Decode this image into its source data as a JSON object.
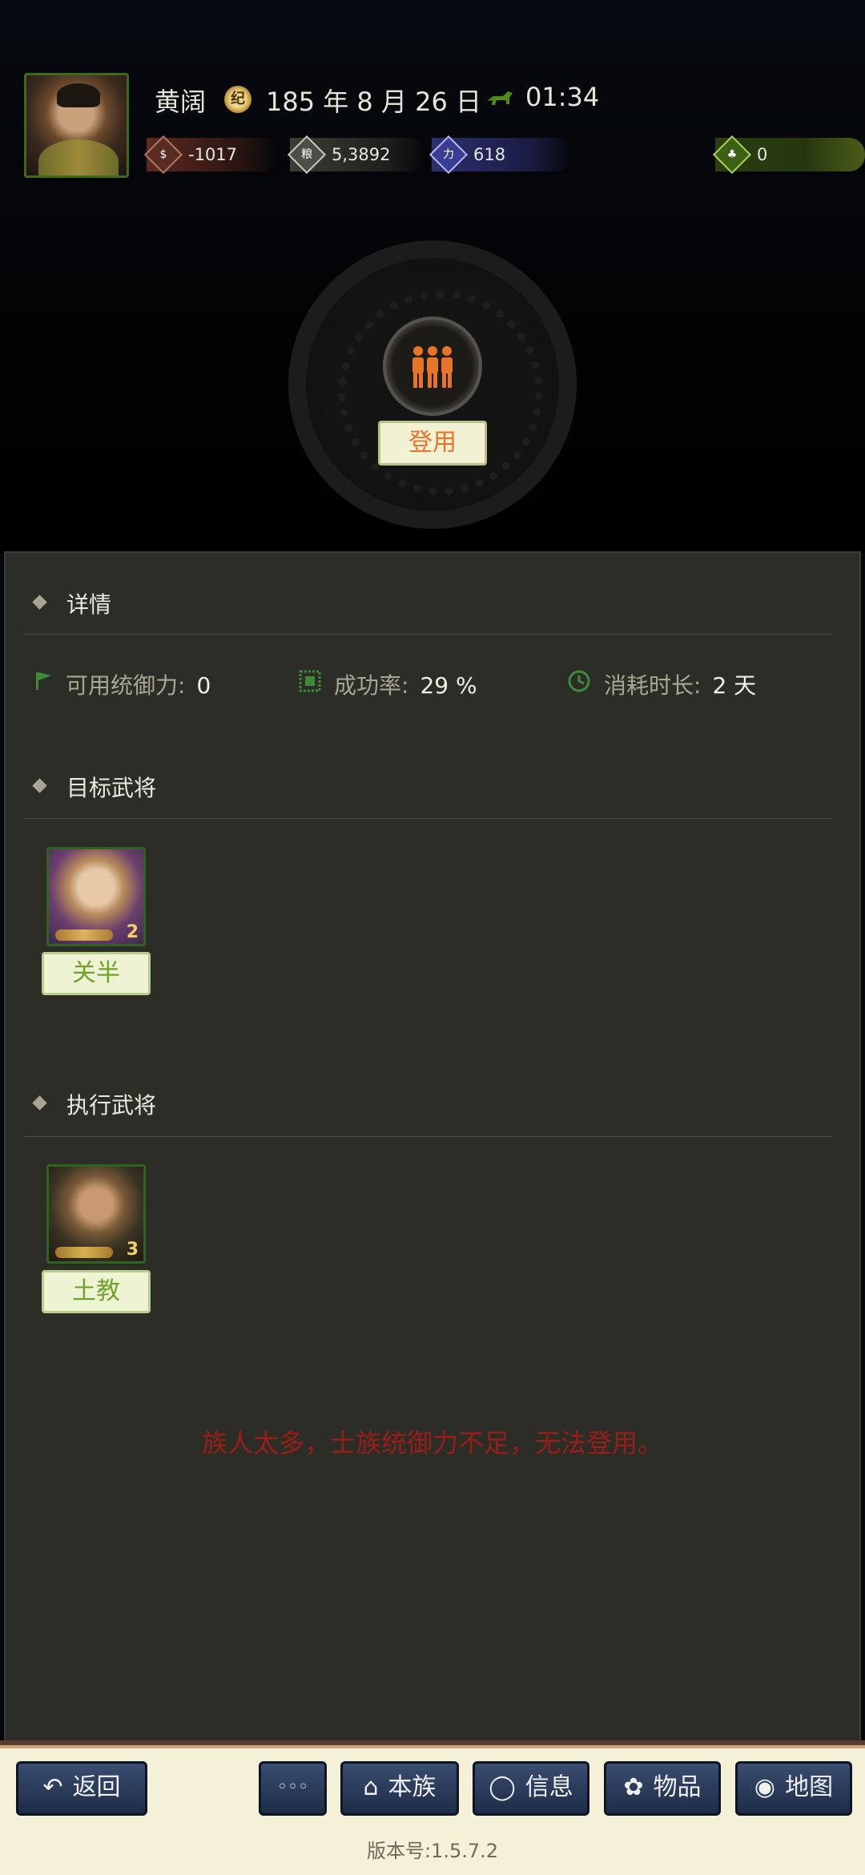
{
  "header": {
    "player_name": "黄阔",
    "date": "185 年 8 月 26 日",
    "time": "01:34",
    "resources": [
      {
        "icon": "coin-icon",
        "value": "-1017"
      },
      {
        "icon": "grain-icon",
        "value": "5,3892"
      },
      {
        "icon": "strength-icon",
        "value": "618"
      },
      {
        "icon": "potion-icon",
        "value": "0"
      }
    ]
  },
  "action": {
    "label": "登用",
    "icon": "people-icon"
  },
  "details": {
    "title": "详情",
    "stats": [
      {
        "label": "可用统御力:",
        "value": "0"
      },
      {
        "label": "成功率:",
        "value": "29 %"
      },
      {
        "label": "消耗时长:",
        "value": "2 天"
      }
    ]
  },
  "target": {
    "title": "目标武将",
    "general": {
      "name": "关半",
      "level": "2"
    }
  },
  "executor": {
    "title": "执行武将",
    "general": {
      "name": "土教",
      "level": "3"
    }
  },
  "warning": "族人太多，士族统御力不足，无法登用。",
  "nav": {
    "back": "返回",
    "more": "◦◦◦",
    "clan": "本族",
    "info": "信息",
    "items": "物品",
    "map": "地图"
  },
  "version": "版本号:1.5.7.2",
  "colors": {
    "accent_orange": "#e8742a",
    "green_tag": "#6fa32b",
    "warning_red": "#9a1d16",
    "panel_bg": "#2d2d28"
  }
}
